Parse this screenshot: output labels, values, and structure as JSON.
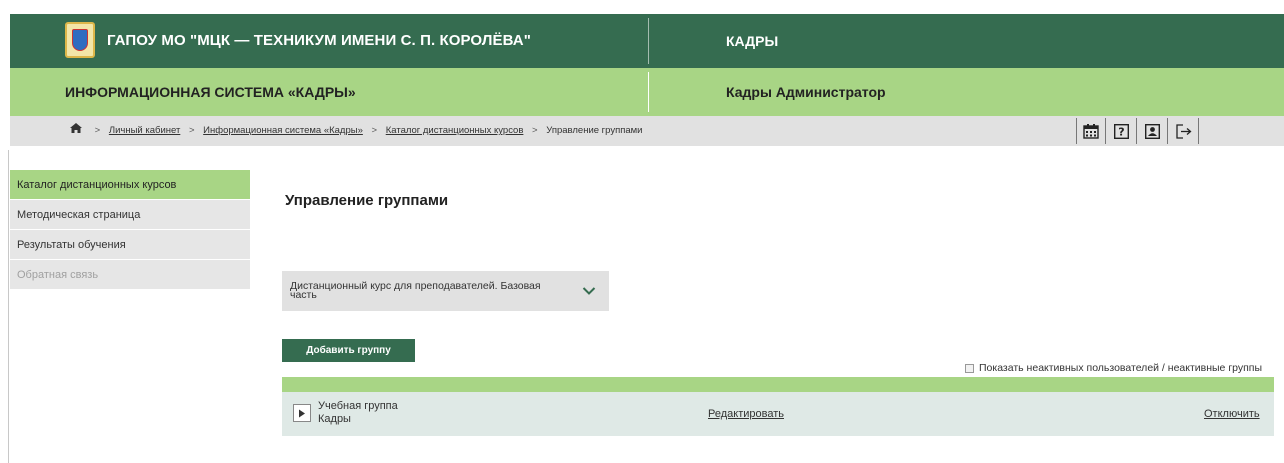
{
  "header": {
    "organization": "ГАПОУ МО \"МЦК — ТЕХНИКУМ ИМЕНИ С. П. КОРОЛЁВА\"",
    "section": "КАДРЫ",
    "system_name": "ИНФОРМАЦИОННАЯ СИСТЕМА «КАДРЫ»",
    "user_role": "Кадры Администратор",
    "colors": {
      "dark_green": "#356c50",
      "light_green": "#a8d585"
    }
  },
  "breadcrumb": {
    "items": [
      {
        "label": "Личный кабинет"
      },
      {
        "label": "Информационная система «Кадры»"
      },
      {
        "label": "Каталог дистанционных курсов"
      },
      {
        "label": "Управление группами"
      }
    ],
    "separator": ">"
  },
  "toolbar": {
    "icons": [
      "calendar-icon",
      "help-icon",
      "profile-icon",
      "logout-icon"
    ]
  },
  "sidebar": {
    "items": [
      {
        "label": "Каталог дистанционных курсов",
        "state": "active"
      },
      {
        "label": "Методическая страница",
        "state": "normal"
      },
      {
        "label": "Результаты обучения",
        "state": "normal"
      },
      {
        "label": "Обратная связь",
        "state": "disabled"
      }
    ]
  },
  "main": {
    "title": "Управление группами",
    "course_select": {
      "selected": "Дистанционный курс для преподавателей. Базовая часть"
    },
    "add_group_button": "Добавить группу",
    "show_inactive_label": "Показать неактивных пользователей / неактивные группы",
    "show_inactive_checked": false,
    "groups": [
      {
        "type": "Учебная группа",
        "name": "Кадры",
        "edit_label": "Редактировать",
        "disable_label": "Отключить"
      }
    ]
  }
}
